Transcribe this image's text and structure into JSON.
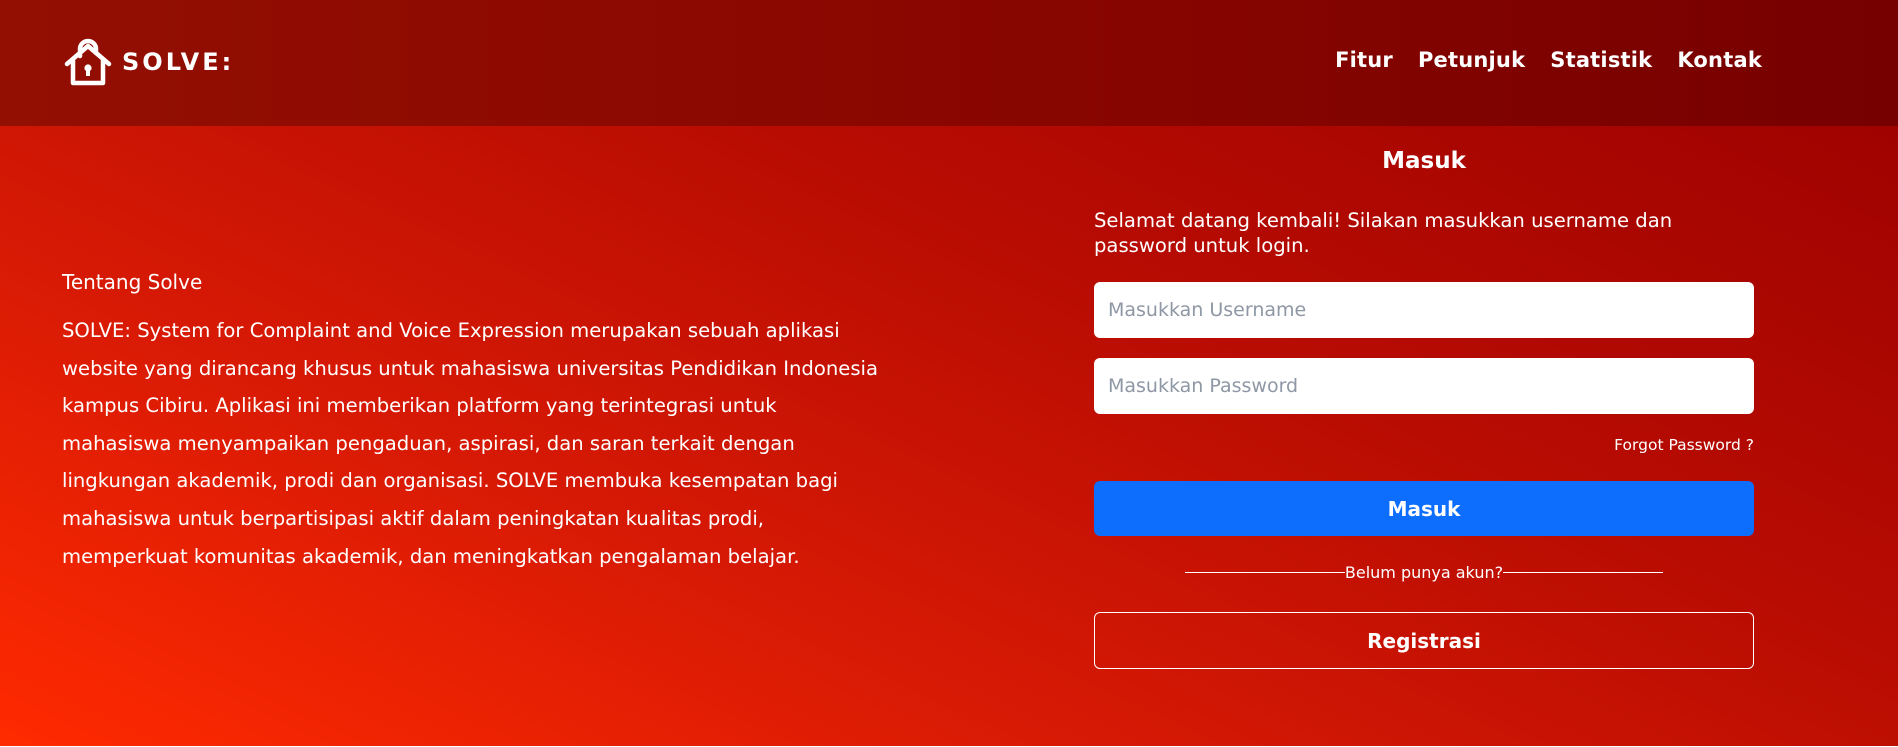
{
  "brand": {
    "name": "SOLVE:",
    "logo_icon": "house-lock-icon"
  },
  "nav": {
    "items": [
      "Fitur",
      "Petunjuk",
      "Statistik",
      "Kontak"
    ]
  },
  "about": {
    "title": "Tentang Solve",
    "body": "SOLVE: System for Complaint and Voice Expression merupakan sebuah aplikasi website yang dirancang khusus untuk mahasiswa universitas Pendidikan Indonesia kampus Cibiru. Aplikasi ini memberikan platform yang terintegrasi untuk mahasiswa menyampaikan pengaduan, aspirasi, dan saran terkait dengan lingkungan akademik, prodi dan organisasi. SOLVE membuka kesempatan bagi mahasiswa untuk berpartisipasi aktif dalam peningkatan kualitas prodi, memperkuat komunitas akademik, dan meningkatkan pengalaman belajar."
  },
  "login": {
    "title": "Masuk",
    "intro": "Selamat datang kembali! Silakan masukkan username dan password untuk login.",
    "username_placeholder": "Masukkan Username",
    "username_value": "",
    "password_placeholder": "Masukkan Password",
    "password_value": "",
    "forgot_label": "Forgot Password ?",
    "submit_label": "Masuk",
    "divider_text": "Belum punya akun?",
    "register_label": "Registrasi"
  },
  "colors": {
    "navbar": "#870500",
    "hero_start": "#ff2a00",
    "hero_end": "#9a0000",
    "primary_button": "#0d6efd",
    "text": "#ffffff"
  }
}
